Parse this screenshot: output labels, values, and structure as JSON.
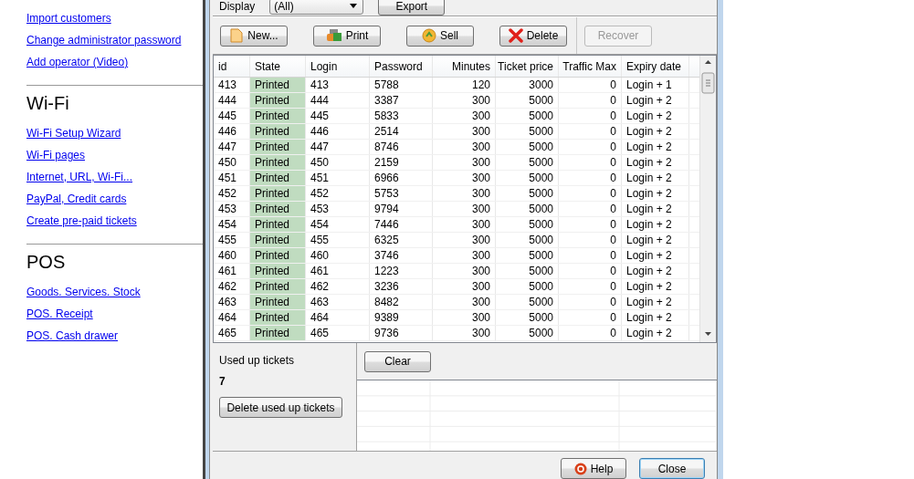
{
  "sidebar": {
    "links": [
      "Import customers",
      "Change administrator password",
      "Add operator (Video)"
    ],
    "sections": [
      {
        "heading": "Wi-Fi",
        "links": [
          "Wi-Fi Setup Wizard",
          "Wi-Fi pages",
          "Internet, URL, Wi-Fi...",
          "PayPal, Credit cards",
          "Create pre-paid tickets"
        ]
      },
      {
        "heading": "POS",
        "links": [
          "Goods. Services. Stock",
          "POS. Receipt",
          "POS. Cash drawer"
        ]
      }
    ]
  },
  "dialog": {
    "display_label": "Display",
    "display_value": "(All)",
    "export_button": "Export",
    "toolbar": [
      {
        "label": "New...",
        "disabled": false
      },
      {
        "label": "Print",
        "disabled": false
      },
      {
        "label": "Sell",
        "disabled": false
      },
      {
        "label": "Delete",
        "disabled": false
      },
      {
        "label": "Recover",
        "disabled": true
      }
    ],
    "table": {
      "columns": [
        "id",
        "State",
        "Login",
        "Password",
        "Minutes",
        "Ticket price",
        "Traffic Max",
        "Expiry date"
      ],
      "rows": [
        {
          "cells": [
            "413",
            "Printed",
            "413",
            "5788",
            "120",
            "3000",
            "0",
            "Login + 1"
          ]
        },
        {
          "cells": [
            "444",
            "Printed",
            "444",
            "3387",
            "300",
            "5000",
            "0",
            "Login + 2"
          ]
        },
        {
          "cells": [
            "445",
            "Printed",
            "445",
            "5833",
            "300",
            "5000",
            "0",
            "Login + 2"
          ]
        },
        {
          "cells": [
            "446",
            "Printed",
            "446",
            "2514",
            "300",
            "5000",
            "0",
            "Login + 2"
          ]
        },
        {
          "cells": [
            "447",
            "Printed",
            "447",
            "8746",
            "300",
            "5000",
            "0",
            "Login + 2"
          ]
        },
        {
          "cells": [
            "450",
            "Printed",
            "450",
            "2159",
            "300",
            "5000",
            "0",
            "Login + 2"
          ]
        },
        {
          "cells": [
            "451",
            "Printed",
            "451",
            "6966",
            "300",
            "5000",
            "0",
            "Login + 2"
          ]
        },
        {
          "cells": [
            "452",
            "Printed",
            "452",
            "5753",
            "300",
            "5000",
            "0",
            "Login + 2"
          ]
        },
        {
          "cells": [
            "453",
            "Printed",
            "453",
            "9794",
            "300",
            "5000",
            "0",
            "Login + 2"
          ]
        },
        {
          "cells": [
            "454",
            "Printed",
            "454",
            "7446",
            "300",
            "5000",
            "0",
            "Login + 2"
          ]
        },
        {
          "cells": [
            "455",
            "Printed",
            "455",
            "6325",
            "300",
            "5000",
            "0",
            "Login + 2"
          ]
        },
        {
          "cells": [
            "460",
            "Printed",
            "460",
            "3746",
            "300",
            "5000",
            "0",
            "Login + 2"
          ]
        },
        {
          "cells": [
            "461",
            "Printed",
            "461",
            "1223",
            "300",
            "5000",
            "0",
            "Login + 2"
          ]
        },
        {
          "cells": [
            "462",
            "Printed",
            "462",
            "3236",
            "300",
            "5000",
            "0",
            "Login + 2"
          ]
        },
        {
          "cells": [
            "463",
            "Printed",
            "463",
            "8482",
            "300",
            "5000",
            "0",
            "Login + 2"
          ]
        },
        {
          "cells": [
            "464",
            "Printed",
            "464",
            "9389",
            "300",
            "5000",
            "0",
            "Login + 2"
          ]
        },
        {
          "cells": [
            "465",
            "Printed",
            "465",
            "9736",
            "300",
            "5000",
            "0",
            "Login + 2"
          ]
        }
      ]
    },
    "used_up": {
      "label": "Used up tickets",
      "count": "7",
      "delete_button": "Delete used up tickets",
      "clear_button": "Clear"
    },
    "footer": [
      {
        "label": "Help",
        "default": false
      },
      {
        "label": "Close",
        "default": true
      }
    ]
  }
}
